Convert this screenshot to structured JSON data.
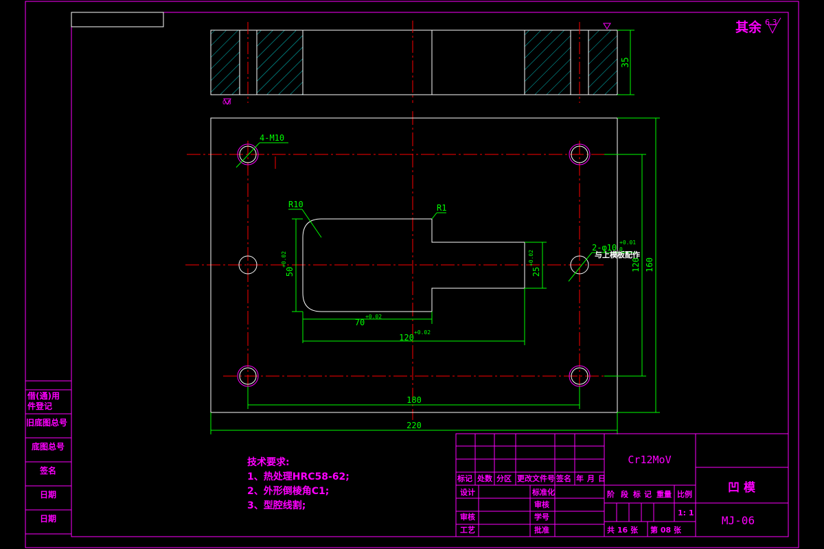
{
  "colors": {
    "frame": "#ff00ff",
    "outline": "#ffffff",
    "center": "#ff0000",
    "dimension": "#00ff00",
    "hatch": "#00c8c8",
    "title_text": "#ff00ff",
    "note_text": "#ff00ff"
  },
  "roughness": {
    "prefix": "其余",
    "value": "6.3"
  },
  "side_view": {
    "thickness_dim": "35",
    "roughness_small": "0.8"
  },
  "plan_view": {
    "hole_callout": "4-M10",
    "cavity_radius": "R10",
    "corner_radius": "R1",
    "pin_callout": "2-φ10",
    "pin_tol": "+0.01",
    "pin_tol2": "0",
    "pin_note": "与上模板配作",
    "dims": {
      "cavity_height": "50",
      "cavity_height_tol": "+0.02",
      "slot_height": "25",
      "slot_height_tol": "+0.02",
      "cavity_width": "70",
      "cavity_width_tol": "+0.02",
      "total_cavity": "120",
      "total_cavity_tol": "+0.02",
      "hole_spacing_x": "180",
      "plate_width": "220",
      "hole_spacing_y": "120",
      "plate_height": "160"
    }
  },
  "tech_requirements": {
    "title": "技术要求:",
    "items": [
      "1、热处理HRC58-62;",
      "2、外形倒棱角C1;",
      "3、型腔线割;"
    ]
  },
  "left_strip": [
    "借(通)用",
    "件登记",
    "旧底图总号",
    "底图总号",
    "签名",
    "日期",
    "日期"
  ],
  "title_block": {
    "material": "Cr12MoV",
    "part_name": "凹  模",
    "drawing_no": "MJ-06",
    "rev_header": [
      "标记",
      "处数",
      "分区",
      "更改文件号",
      "签名",
      "年",
      "月",
      "日"
    ],
    "rows": [
      "设计",
      "审核",
      "工艺"
    ],
    "mid_labels": [
      "标准化",
      "审核",
      "学号",
      "批准"
    ],
    "stage_header": [
      "阶",
      "段",
      "标",
      "记",
      "重量",
      "比例"
    ],
    "scale": "1: 1",
    "sheets_total": "共 16 张",
    "sheet_no": "第 08 张"
  }
}
